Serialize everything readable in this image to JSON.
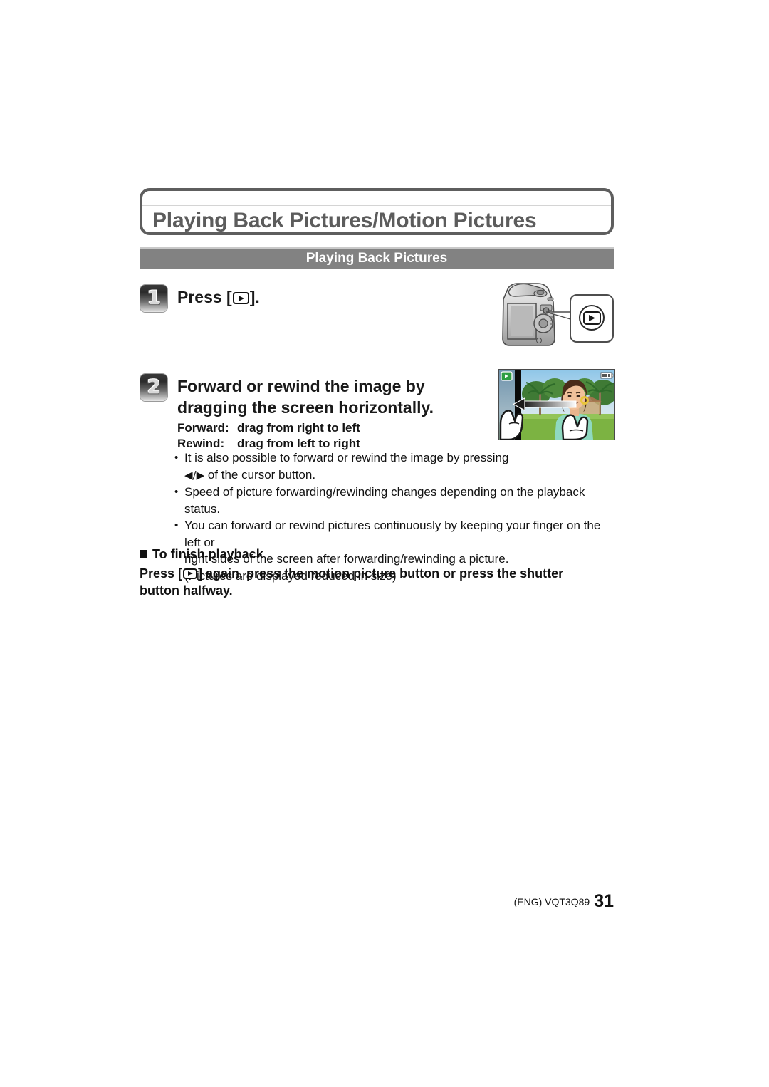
{
  "document": {
    "title": "Playing Back Pictures/Motion Pictures",
    "section_band": "Playing Back Pictures"
  },
  "steps": [
    {
      "number": "1",
      "heading_prefix": "Press [",
      "heading_suffix": "].",
      "icon": "playback-icon"
    },
    {
      "number": "2",
      "heading_line1": "Forward or rewind the image by dragging the",
      "heading_line2": "screen horizontally."
    }
  ],
  "drag_directions": [
    {
      "label": "Forward:",
      "value": "drag from right to left"
    },
    {
      "label": "Rewind:",
      "value": "drag from left to right"
    }
  ],
  "bullets": [
    {
      "line1": "It is also possible to forward or rewind the image by pressing",
      "arrows": "◀/▶",
      "line2_rest": " of the cursor button."
    },
    {
      "line1": "Speed of picture forwarding/rewinding changes depending on the playback status."
    },
    {
      "line1": "You can forward or rewind pictures continuously by keeping your finger on the left or",
      "line2": "right sides of the screen after forwarding/rewinding a picture.",
      "line3": "(Pictures are displayed reduced in size)"
    }
  ],
  "finish_section": {
    "heading": "To finish playback",
    "body_part1": "Press [",
    "body_part2": "] again, press the motion picture button or press the shutter button halfway."
  },
  "footer": {
    "code": "(ENG) VQT3Q89",
    "page_number": "31"
  },
  "figures": {
    "camera": {
      "name": "camera-rear-view-illustration",
      "callout_icon": "playback-button-icon"
    },
    "photo": {
      "name": "playback-screen-drag-photo",
      "badge_icon": "playback-mode-badge",
      "battery_icon": "battery-indicator",
      "arrow_icon": "drag-left-arrow",
      "hand_icons": "hand-drag-gesture"
    }
  },
  "colors": {
    "band": "#828282",
    "title_text": "#5c5c5c",
    "border": "#5e5e5e",
    "body_text": "#111111"
  }
}
